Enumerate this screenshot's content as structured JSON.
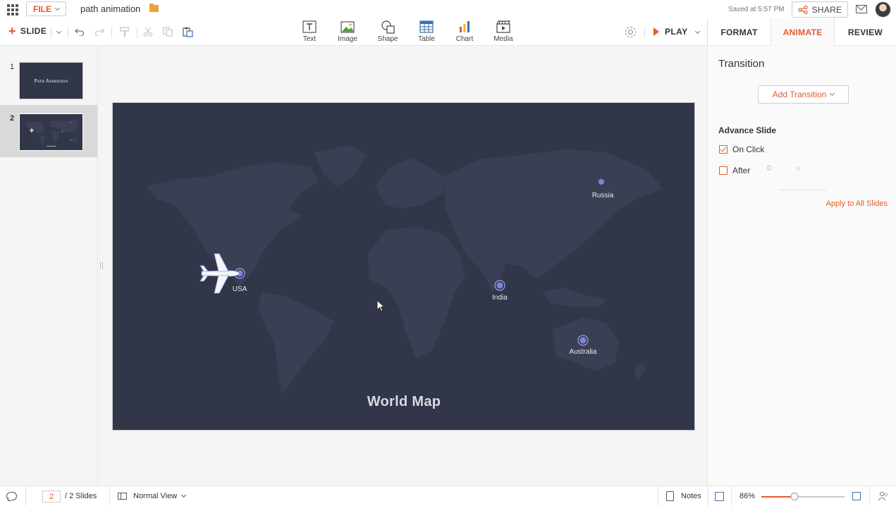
{
  "topbar": {
    "file_label": "FILE",
    "document_title": "path animation",
    "saved_status": "Saved at 5:57 PM",
    "share_label": "SHARE"
  },
  "toolbar": {
    "slide_label": "SLIDE",
    "insert_items": [
      {
        "label": "Text",
        "icon": "text-box-icon"
      },
      {
        "label": "Image",
        "icon": "image-icon"
      },
      {
        "label": "Shape",
        "icon": "shape-icon"
      },
      {
        "label": "Table",
        "icon": "table-icon"
      },
      {
        "label": "Chart",
        "icon": "chart-icon"
      },
      {
        "label": "Media",
        "icon": "media-icon"
      }
    ],
    "play_label": "PLAY",
    "tabs": [
      {
        "label": "FORMAT",
        "active": false
      },
      {
        "label": "ANIMATE",
        "active": true
      },
      {
        "label": "REVIEW",
        "active": false
      }
    ]
  },
  "slide_panel": {
    "slides": [
      {
        "number": "1",
        "title": "Path Animation",
        "selected": false
      },
      {
        "number": "2",
        "title": "",
        "selected": true
      }
    ]
  },
  "canvas": {
    "map_title": "World Map",
    "locations": [
      {
        "name": "USA"
      },
      {
        "name": "Russia"
      },
      {
        "name": "India"
      },
      {
        "name": "Australia"
      }
    ]
  },
  "right_panel": {
    "heading": "Transition",
    "add_transition_label": "Add Transition",
    "advance_heading": "Advance Slide",
    "on_click_label": "On Click",
    "on_click_checked": true,
    "after_label": "After",
    "after_checked": false,
    "after_value": "0",
    "after_unit": "s",
    "apply_all_label": "Apply to All Slides"
  },
  "statusbar": {
    "current_page": "2",
    "total_slides": "/ 2 Slides",
    "view_label": "Normal View",
    "notes_label": "Notes",
    "zoom_label": "86%",
    "zoom_fraction": 0.4
  },
  "colors": {
    "accent": "#e55a2b",
    "slide_background": "#323649",
    "map_land": "#3b4054",
    "marker": "#7b86e0"
  }
}
